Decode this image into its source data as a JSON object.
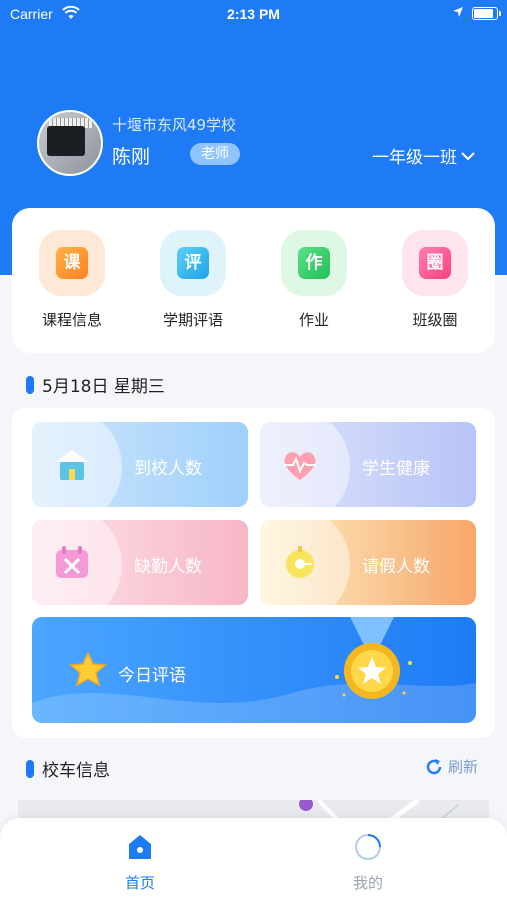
{
  "status_bar": {
    "carrier": "Carrier",
    "time": "2:13 PM",
    "battery_level": 0.95
  },
  "profile": {
    "school": "十堰市东风49学校",
    "name": "陈刚",
    "role": "老师",
    "class": "一年级一班"
  },
  "quick_actions": [
    {
      "label": "课程信息",
      "glyph": "课",
      "icon": "course-icon",
      "color": "#ff8a1f"
    },
    {
      "label": "学期评语",
      "glyph": "评",
      "icon": "comment-icon",
      "color": "#1fb6e8"
    },
    {
      "label": "作业",
      "glyph": "作",
      "icon": "homework-icon",
      "color": "#2fcf5f"
    },
    {
      "label": "班级圈",
      "glyph": "圈",
      "icon": "class-circle-icon",
      "color": "#ff4f8e"
    }
  ],
  "date_section": {
    "title": "5月18日 星期三"
  },
  "stats": [
    {
      "label": "到校人数",
      "icon": "school-arrival-icon"
    },
    {
      "label": "学生健康",
      "icon": "heartbeat-icon"
    },
    {
      "label": "缺勤人数",
      "icon": "absence-icon"
    },
    {
      "label": "请假人数",
      "icon": "leave-clock-icon"
    }
  ],
  "banner": {
    "label": "今日评语"
  },
  "bus_section": {
    "title": "校车信息",
    "refresh_label": "刷新"
  },
  "tabbar": {
    "home": "首页",
    "mine": "我的"
  },
  "colors": {
    "primary": "#1e7bf5",
    "tab_active": "#1e7bf5",
    "tab_inactive": "#9aa3b2"
  }
}
